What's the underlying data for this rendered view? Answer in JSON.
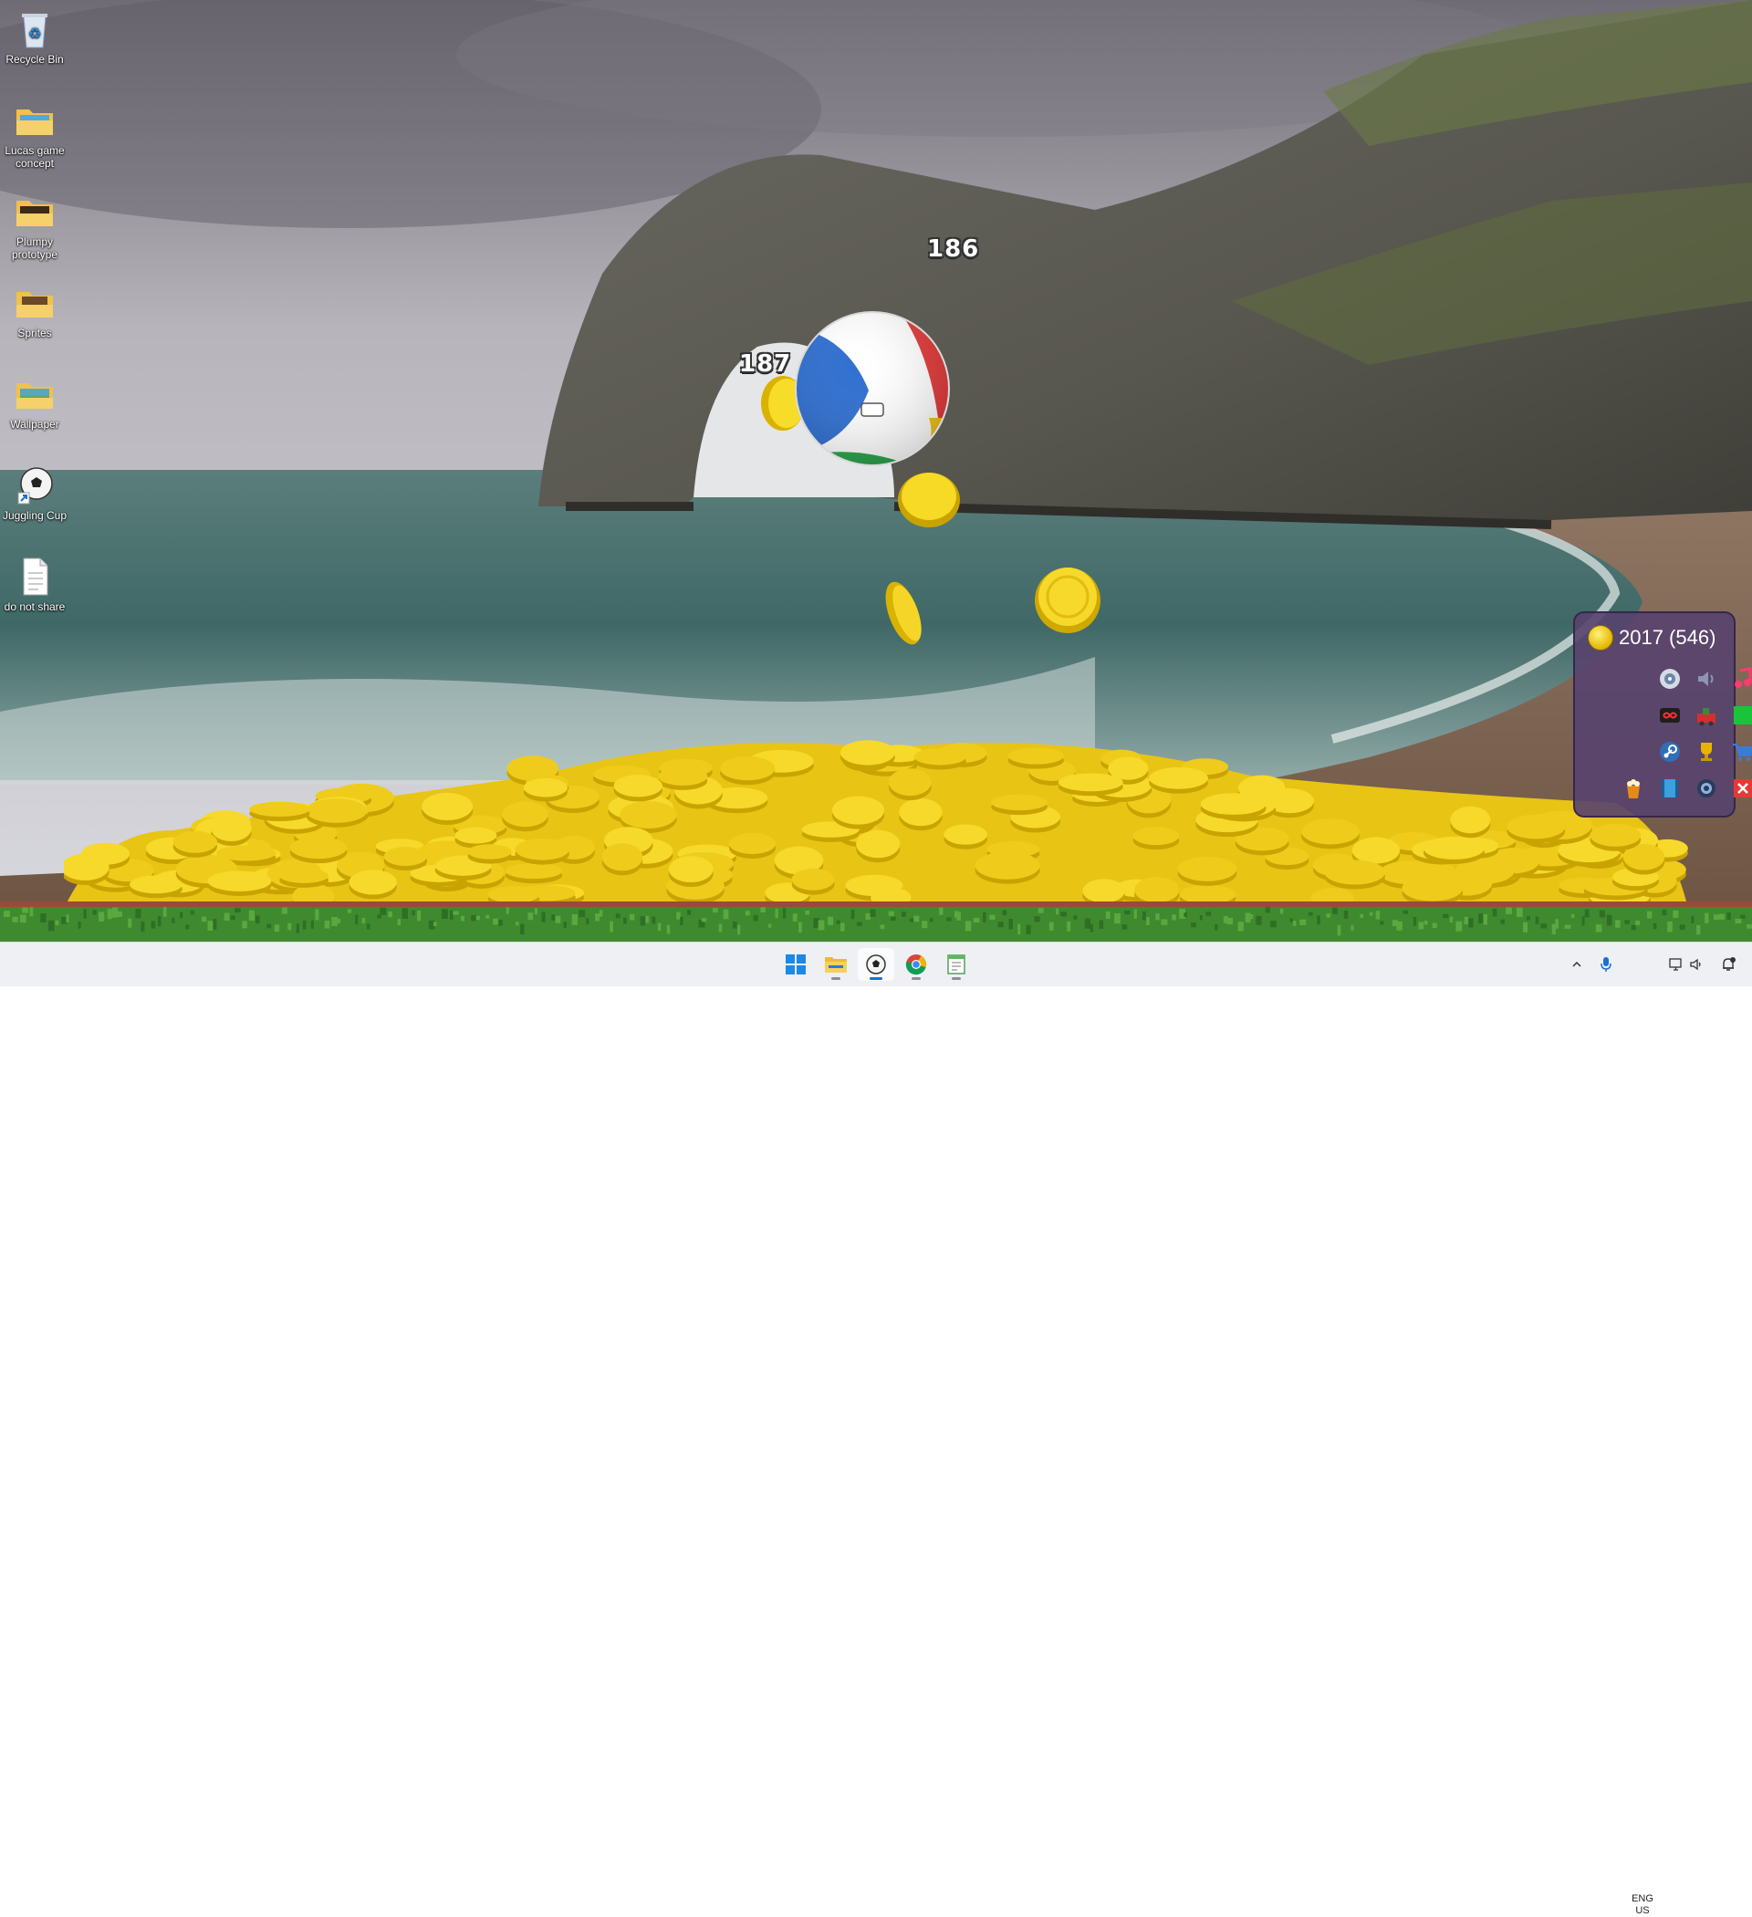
{
  "desktop": {
    "icons": [
      {
        "label": "Recycle Bin",
        "icon": "recycle-bin-icon"
      },
      {
        "label": "Lucas game concept",
        "icon": "folder-icon"
      },
      {
        "label": "Plumpy prototype",
        "icon": "folder-icon"
      },
      {
        "label": "Sprites",
        "icon": "folder-icon"
      },
      {
        "label": "Wallpaper",
        "icon": "folder-icon"
      },
      {
        "label": "Juggling Cup",
        "icon": "soccer-ball-shortcut-icon"
      },
      {
        "label": "do not share",
        "icon": "text-file-icon"
      }
    ]
  },
  "game": {
    "score_popups": [
      "186",
      "187"
    ],
    "coin_total": "2017 (546)",
    "tools": [
      "target-icon",
      "speaker-icon",
      "music-note-icon",
      "infinity-icon",
      "train-icon",
      "green-square-icon",
      "steam-icon",
      "trophy-icon",
      "cart-icon",
      "popcorn-icon",
      "film-icon",
      "camera-icon",
      "close-icon"
    ],
    "colors": {
      "coin": "#f2d21b",
      "panel": "#58426e",
      "close": "#e53935"
    }
  },
  "taskbar": {
    "apps": [
      "start-icon",
      "file-explorer-icon",
      "juggling-cup-icon",
      "chrome-icon",
      "notepad-icon"
    ],
    "active_app": "juggling-cup-icon",
    "lang_line1": "ENG",
    "lang_line2": "US"
  }
}
